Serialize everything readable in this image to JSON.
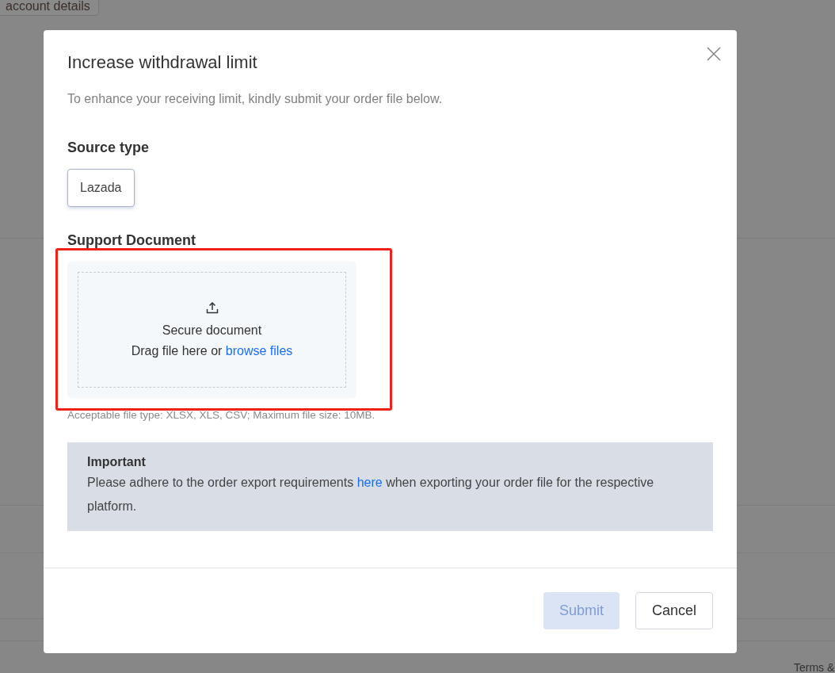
{
  "background": {
    "account_button": "account details",
    "footer_link": "Terms &"
  },
  "dialog": {
    "title": "Increase withdrawal limit",
    "subtitle": "To enhance your receiving limit, kindly submit your order file below.",
    "source_type": {
      "label": "Source type",
      "options": [
        {
          "label": "Lazada",
          "selected": true
        }
      ]
    },
    "support_document": {
      "label": "Support Document",
      "upload_title": "Secure document",
      "upload_prompt": "Drag file here or",
      "browse_link": "browse files",
      "hint": "Acceptable file type: XLSX, XLS, CSV; Maximum file size: 10MB.",
      "highlighted": true
    },
    "notice": {
      "title": "Important",
      "text_before": "Please adhere to the order export requirements",
      "link": "here",
      "text_after": "when exporting your order file for the respective platform."
    },
    "buttons": [
      {
        "label": "Submit",
        "kind": "primary",
        "disabled": true
      },
      {
        "label": "Cancel",
        "kind": "secondary",
        "disabled": false
      }
    ]
  }
}
